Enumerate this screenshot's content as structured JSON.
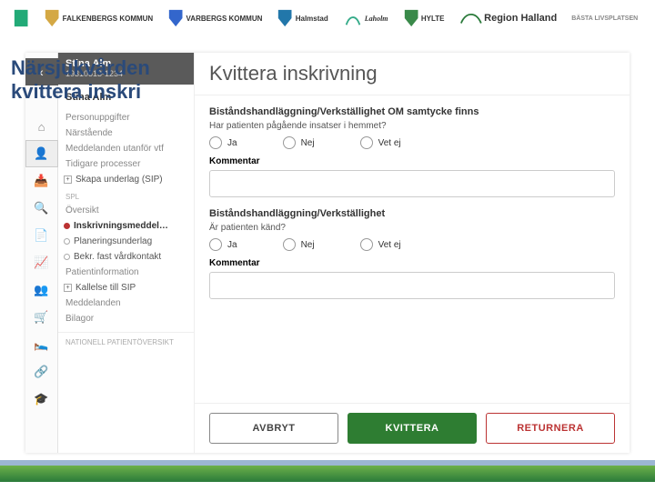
{
  "logos": [
    "Kungsbacka",
    "FALKENBERGS KOMMUN",
    "VARBERGS KOMMUN",
    "Halmstad",
    "Laholm",
    "HYLTE",
    "Region Halland",
    "BÄSTA LIVSPLATSEN"
  ],
  "slide_title_l1": "Närsjukvården",
  "slide_title_l2": " kvittera inskri",
  "patient": {
    "name": "Stina Alm",
    "id": "19310513-1234"
  },
  "side": {
    "name": "Stina Alm",
    "items1": [
      "Personuppgifter",
      "Närstående",
      "Meddelanden utanför vtf",
      "Tidigare processer"
    ],
    "skapa": "Skapa underlag (SIP)",
    "lab_spl": "SPL",
    "oversikt": "Översikt",
    "inskr": "Inskrivningsmeddel…",
    "plan": "Planeringsunderlag",
    "bekr": "Bekr. fast vårdkontakt",
    "patinfo": "Patientinformation",
    "kallelse": "Kallelse till SIP",
    "medd": "Meddelanden",
    "bilagor": "Bilagor",
    "npo": "NATIONELL PATIENTÖVERSIKT"
  },
  "modal": {
    "title": "Kvittera inskrivning",
    "q1_title": "Biståndshandläggning/Verkställighet OM samtycke finns",
    "q1_sub": "Har patienten pågående insatser i hemmet?",
    "q2_title": "Biståndshandläggning/Verkställighet",
    "q2_sub": "Är patienten känd?",
    "opt_yes": "Ja",
    "opt_no": "Nej",
    "opt_dk": "Vet ej",
    "comment": "Kommentar",
    "cancel": "AVBRYT",
    "ok": "KVITTERA",
    "ret": "RETURNERA"
  }
}
